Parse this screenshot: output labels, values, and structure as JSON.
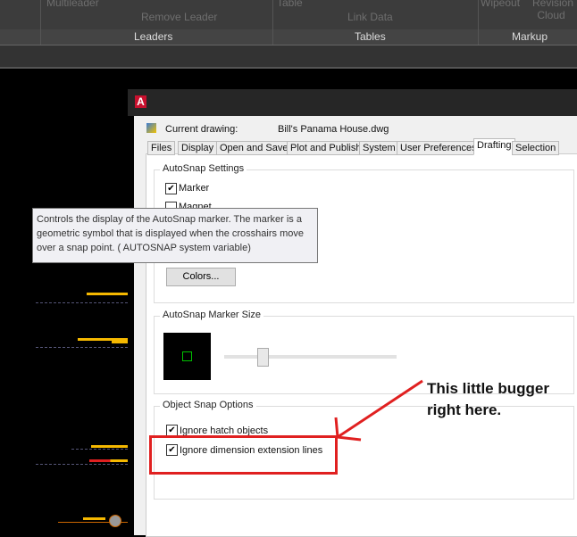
{
  "ribbon": {
    "top_items": [
      "Multileader",
      "Remove Leader",
      "Table",
      "Link Data",
      "Wipeout",
      "Revision Cloud"
    ],
    "panels": [
      "Leaders",
      "Tables",
      "Markup"
    ]
  },
  "dialog": {
    "current_drawing_label": "Current drawing:",
    "current_drawing_value": "Bill's Panama House.dwg",
    "tabs": [
      "Files",
      "Display",
      "Open and Save",
      "Plot and Publish",
      "System",
      "User Preferences",
      "Drafting",
      "Selection"
    ],
    "active_tab": "Drafting",
    "autosnap_settings": {
      "title": "AutoSnap Settings",
      "marker_label": "Marker",
      "marker_checked": true,
      "magnet_label": "Magnet",
      "colors_button": "Colors..."
    },
    "marker_size": {
      "title": "AutoSnap Marker Size",
      "slider_fraction": 0.2,
      "marker_color": "#00c000"
    },
    "object_snap": {
      "title": "Object Snap Options",
      "ignore_hatch_label": "Ignore hatch objects",
      "ignore_hatch_checked": true,
      "ignore_dim_label": "Ignore dimension extension lines",
      "ignore_dim_checked": true
    }
  },
  "tooltip": "Controls the display of the AutoSnap marker. The marker is a geometric symbol that is displayed when the crosshairs move over a snap point. ( AUTOSNAP system variable)",
  "annotation": {
    "text": "This little bugger right here.",
    "color": "#e02020"
  }
}
